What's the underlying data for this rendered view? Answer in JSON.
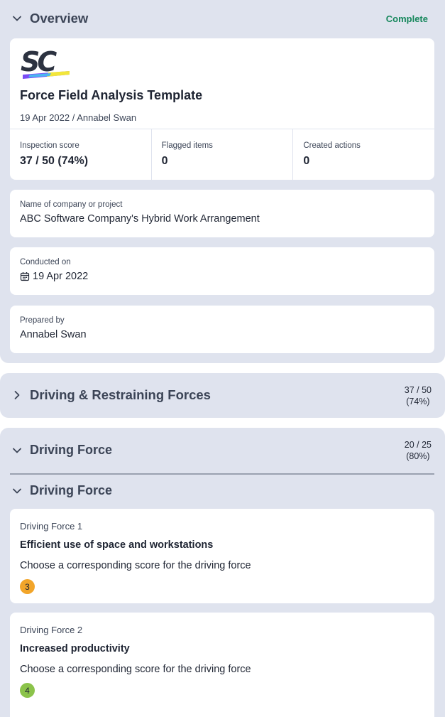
{
  "overview": {
    "title": "Overview",
    "status": "Complete",
    "status_color": "#16875c",
    "logo_icon": "sc-logo",
    "template_title": "Force Field Analysis Template",
    "meta": "19 Apr 2022 / Annabel Swan",
    "stats": [
      {
        "label": "Inspection score",
        "value": "37 / 50 (74%)"
      },
      {
        "label": "Flagged items",
        "value": "0"
      },
      {
        "label": "Created actions",
        "value": "0"
      }
    ],
    "fields": [
      {
        "label": "Name of company or project",
        "value": "ABC Software Company's Hybrid Work Arrangement"
      },
      {
        "label": "Conducted on",
        "value": "19 Apr 2022",
        "icon": "calendar-icon"
      },
      {
        "label": "Prepared by",
        "value": "Annabel Swan"
      }
    ]
  },
  "driving_restraining": {
    "title": "Driving & Restraining Forces",
    "score_line1": "37 / 50",
    "score_line2": "(74%)"
  },
  "driving_force": {
    "title": "Driving Force",
    "score_line1": "20 / 25",
    "score_line2": "(80%)",
    "subsection_title": "Driving Force",
    "questions": [
      {
        "label": "Driving Force 1",
        "title": "Efficient use of space and workstations",
        "desc": "Choose a corresponding score for the driving force",
        "score": "3",
        "badge_color": "#f2a52a"
      },
      {
        "label": "Driving Force 2",
        "title": "Increased productivity",
        "desc": "Choose a corresponding score for the driving force",
        "score": "4",
        "badge_color": "#8bc34a"
      }
    ]
  }
}
